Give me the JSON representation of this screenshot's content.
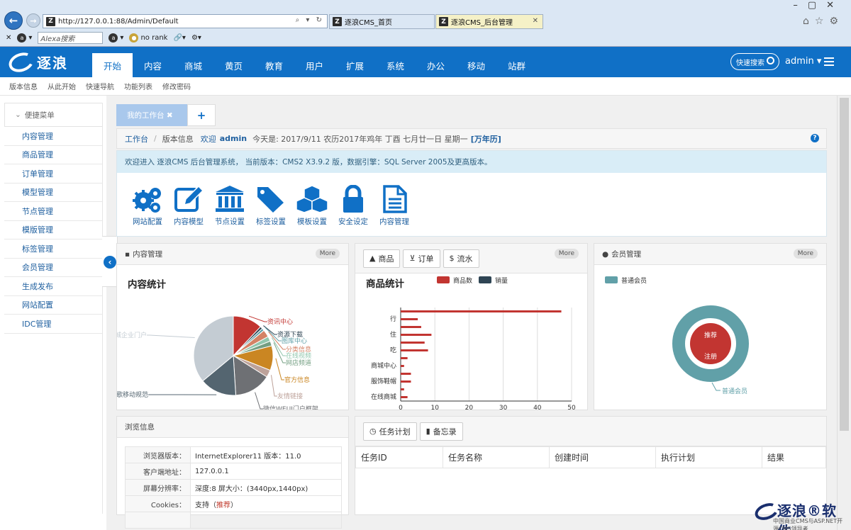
{
  "browser": {
    "url": "http://127.0.0.1:88/Admin/Default",
    "tabs": [
      {
        "label": "逐浪CMS_首页"
      },
      {
        "label": "逐浪CMS_后台管理"
      }
    ],
    "toolbar": {
      "alexa_placeholder": "Alexa搜索",
      "rank": "no rank"
    }
  },
  "header": {
    "brand": "逐浪",
    "nav": [
      "开始",
      "内容",
      "商城",
      "黄页",
      "教育",
      "用户",
      "扩展",
      "系统",
      "办公",
      "移动",
      "站群"
    ],
    "active_nav": 0,
    "quick_search": "快速搜索",
    "user": "admin ▾"
  },
  "subnav": [
    "版本信息",
    "从此开始",
    "快速导航",
    "功能列表",
    "修改密码"
  ],
  "sidebar": {
    "title": "便捷菜单",
    "items": [
      "内容管理",
      "商品管理",
      "订单管理",
      "模型管理",
      "节点管理",
      "模版管理",
      "标签管理",
      "会员管理",
      "生成发布",
      "网站配置",
      "IDC管理"
    ]
  },
  "workspace": {
    "tab": "我的工作台 ✖",
    "add": "+"
  },
  "breadcrumb": {
    "home": "工作台",
    "sep": "/",
    "current": "版本信息",
    "welcome": "欢迎",
    "user": "admin",
    "date": "今天是: 2017/9/11 农历2017年鸡年 丁酉 七月廿一日 星期一",
    "calendar": "[万年历]",
    "help": "?"
  },
  "welcome": {
    "text": "欢迎进入 逐浪CMS 后台管理系统， 当前版本：CMS2 X3.9.2 版，数据引擎：SQL Server 2005及更高版本。",
    "quick": [
      {
        "label": "网站配置",
        "icon": "gears-icon"
      },
      {
        "label": "内容模型",
        "icon": "edit-icon"
      },
      {
        "label": "节点设置",
        "icon": "bank-icon"
      },
      {
        "label": "标签设置",
        "icon": "tags-icon"
      },
      {
        "label": "模板设置",
        "icon": "cubes-icon"
      },
      {
        "label": "安全设定",
        "icon": "lock-icon"
      },
      {
        "label": "内容管理",
        "icon": "file-icon"
      }
    ]
  },
  "panels": {
    "content": {
      "title": "内容管理",
      "more": "More",
      "chart_title": "内容统计"
    },
    "goods": {
      "tabs": [
        "商品",
        "订单",
        "流水"
      ],
      "more": "More",
      "chart_title": "商品统计"
    },
    "members": {
      "title": "会员管理",
      "more": "More"
    },
    "browse": {
      "title": "浏览信息",
      "rows": [
        {
          "k": "浏览器版本：",
          "v": "InternetExplorer11 版本：11.0"
        },
        {
          "k": "客户端地址：",
          "v": "127.0.0.1"
        },
        {
          "k": "屏幕分辨率：",
          "v": "深度:8 屏大小：(3440px,1440px)"
        },
        {
          "k": "Cookies：",
          "v_pre": "支持（",
          "v_hl": "推荐",
          "v_post": "）"
        }
      ]
    },
    "tasks": {
      "tabs": [
        "任务计划",
        "备忘录"
      ],
      "columns": [
        "任务ID",
        "任务名称",
        "创建时间",
        "执行计划",
        "结果"
      ]
    }
  },
  "watermark": {
    "title": "逐浪®软件",
    "sub": "中国商业CMS与ASP.NET开源CMS领导者"
  },
  "chart_data": [
    {
      "type": "pie",
      "title": "内容统计",
      "labels": [
        "资讯中心",
        "资源下载",
        "图库中心",
        "分类信息",
        "在线视频",
        "网店频道",
        "官方信息",
        "友情链接",
        "微信WEUI门户框架",
        "谷歌移动规范",
        "商城企业门户"
      ],
      "values": [
        12,
        1,
        1,
        3,
        2,
        2,
        10,
        3,
        15,
        15,
        36
      ],
      "colors": [
        "#c23531",
        "#2f4554",
        "#61a0a8",
        "#d48265",
        "#91c7ae",
        "#749f83",
        "#ca8622",
        "#bda29a",
        "#6e7074",
        "#546570",
        "#c4ccd3"
      ]
    },
    {
      "type": "bar",
      "title": "商品统计",
      "orientation": "horizontal",
      "series": [
        {
          "name": "商品数",
          "color": "#c23531"
        },
        {
          "name": "销量",
          "color": "#2f4554"
        }
      ],
      "categories": [
        "在线商城",
        "",
        "服饰鞋帽",
        "",
        "商城中心",
        "",
        "吃",
        "",
        "住",
        "",
        "行",
        ""
      ],
      "values": [
        2,
        1,
        3,
        3,
        1,
        2,
        8,
        7,
        9,
        6,
        5,
        47
      ],
      "xlim": [
        0,
        50
      ],
      "xticks": [
        0,
        10,
        20,
        30,
        40,
        50
      ]
    },
    {
      "type": "pie",
      "subtype": "donut",
      "series": [
        {
          "name": "普通会员",
          "color": "#61a0a8"
        }
      ],
      "inner_labels": [
        "推荐",
        "注册"
      ],
      "inner_color": "#c23531",
      "outer_label": "普通会员"
    }
  ]
}
